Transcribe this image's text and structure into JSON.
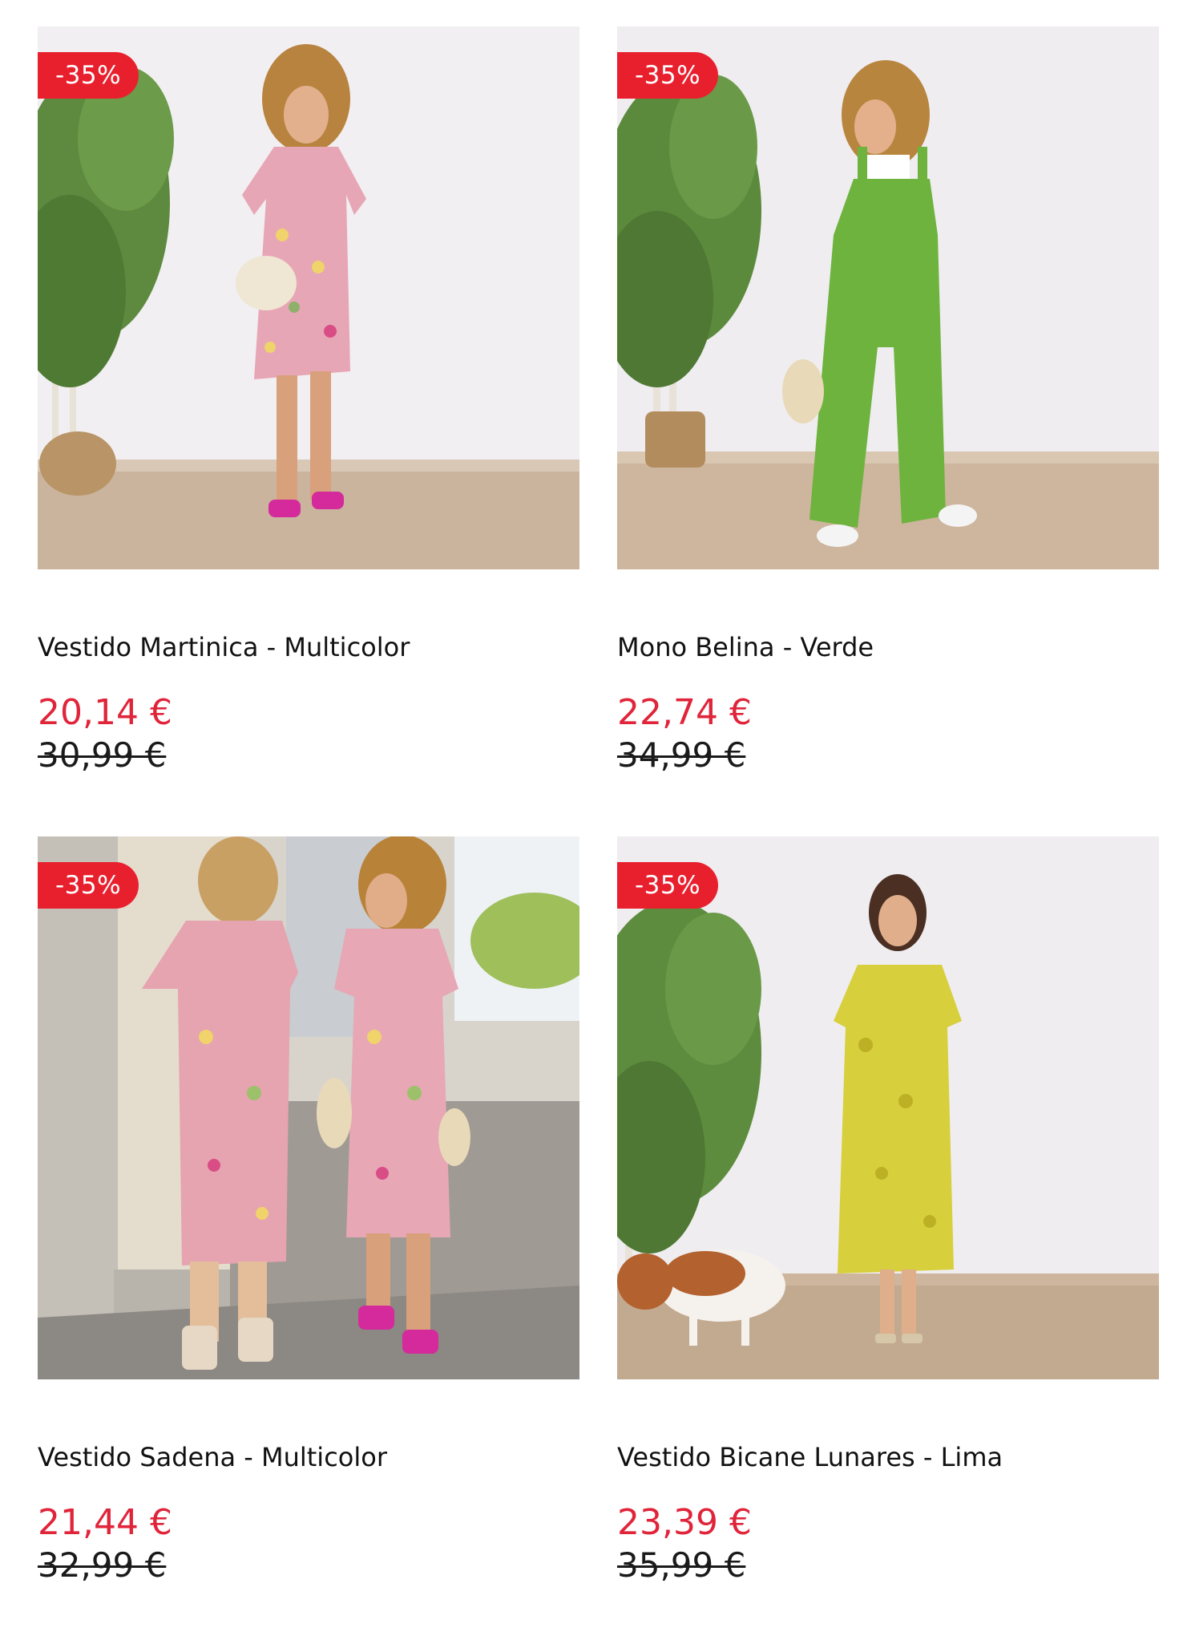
{
  "products": [
    {
      "discount": "-35%",
      "name": "Vestido Martinica - Multicolor",
      "price": "20,14 €",
      "old_price": "30,99 €"
    },
    {
      "discount": "-35%",
      "name": "Mono Belina - Verde",
      "price": "22,74 €",
      "old_price": "34,99 €"
    },
    {
      "discount": "-35%",
      "name": "Vestido Sadena - Multicolor",
      "price": "21,44 €",
      "old_price": "32,99 €"
    },
    {
      "discount": "-35%",
      "name": "Vestido Bicane Lunares - Lima",
      "price": "23,39 €",
      "old_price": "35,99 €"
    }
  ],
  "colors": {
    "badge": "#e8202e",
    "sale_price": "#e0243a",
    "old_price": "#1a1a1a"
  }
}
